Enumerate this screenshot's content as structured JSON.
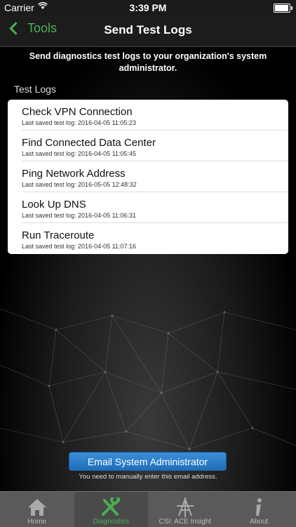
{
  "status": {
    "carrier": "Carrier",
    "time": "3:39 PM"
  },
  "nav": {
    "back_label": "Tools",
    "title": "Send Test Logs"
  },
  "description": "Send diagnostics test logs to your organization's system administrator.",
  "section_title": "Test Logs",
  "logs": [
    {
      "name": "Check VPN Connection",
      "saved": "Last saved test log: 2016-04-05 11:05:23"
    },
    {
      "name": "Find Connected Data Center",
      "saved": "Last saved test log: 2016-04-05 11:05:45"
    },
    {
      "name": "Ping Network Address",
      "saved": "Last saved test log: 2016-05-05 12:48:32"
    },
    {
      "name": "Look Up DNS",
      "saved": "Last saved test log: 2016-04-05 11:06:31"
    },
    {
      "name": "Run Traceroute",
      "saved": "Last saved test log: 2016-04-05 11:07:16"
    }
  ],
  "email_button": "Email System Administrator",
  "email_note": "You need to manually enter this email address.",
  "tabs": [
    {
      "label": "Home",
      "icon": "home-icon"
    },
    {
      "label": "Diagnostics",
      "icon": "tools-icon",
      "active": true
    },
    {
      "label": "CSI: ACE Insight",
      "icon": "ace-insight-icon"
    },
    {
      "label": "About",
      "icon": "info-icon"
    }
  ],
  "colors": {
    "accent": "#4caf50",
    "button": "#2a7fcc",
    "tabbar": "#5a5a5a"
  }
}
